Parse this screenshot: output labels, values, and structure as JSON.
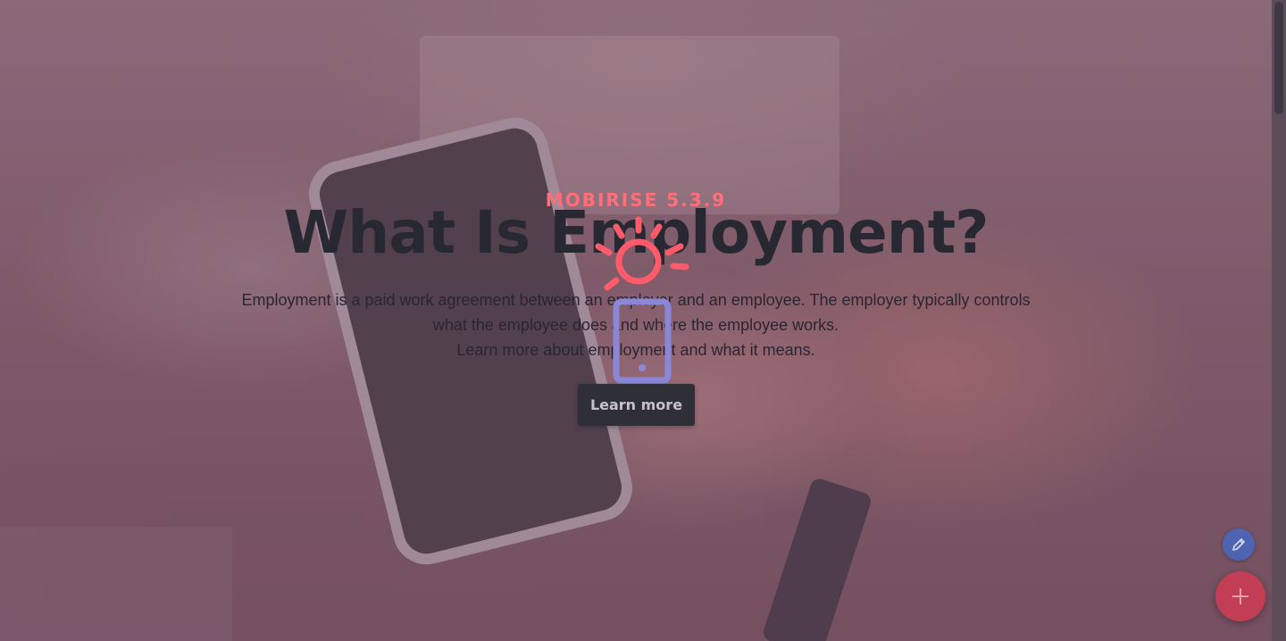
{
  "hero": {
    "eyebrow": "MOBIRISE 5.3.9",
    "title": "What Is Employment?",
    "description_lines": [
      "Employment is a paid work agreement between an employer and an employee. The employer typically controls",
      "what the employee does and where the employee works.",
      "Learn more about employment and what it means."
    ],
    "button_label": "Learn more"
  },
  "icons": {
    "loader": "sun-phone-loader-icon",
    "edit": "pencil-icon",
    "add": "plus-icon"
  },
  "colors": {
    "eyebrow": "#ff6f7a",
    "title": "#272831",
    "button_bg": "#2f3037",
    "loader_sun": "#ff5b6b",
    "loader_phone": "#8a86d8",
    "fab_edit": "#4e64b0",
    "fab_add": "#c23e55"
  }
}
